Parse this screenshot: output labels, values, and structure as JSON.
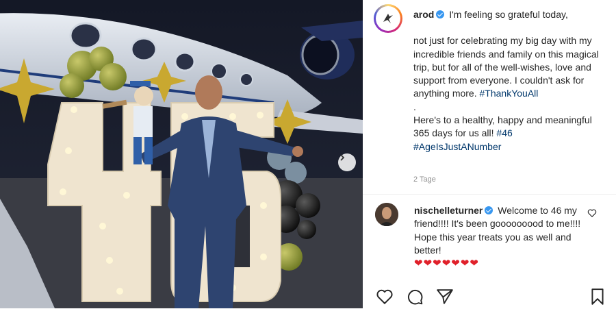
{
  "post": {
    "username": "arod",
    "caption_lines": [
      "I'm feeling so grateful today,",
      "not just for celebrating my big day with my incredible friends and family on this magical trip, but for all of the well-wishes, love and support from everyone. I couldn't ask for anything more.",
      "#ThankYouAll",
      ".",
      "Here's to a healthy, happy and meaningful 365 days for us all!",
      "#46",
      "#AgeIsJustANumber"
    ],
    "time": "2 Tage"
  },
  "comment": {
    "username": "nischelleturner",
    "text": "Welcome to 46 my friend!!!! It's been gooooooood to me!!!! Hope this year treats you as well and better!",
    "hearts": "❤❤❤❤❤❤❤"
  },
  "photo": {
    "marquee_digits": [
      "4",
      "6"
    ]
  },
  "colors": {
    "verified": "#3897f0",
    "hashtag": "#00376b",
    "heart": "#e0202a"
  },
  "icons": [
    "verified-badge-icon",
    "chevron-right-icon",
    "heart-icon",
    "comment-icon",
    "share-icon",
    "bookmark-icon"
  ]
}
